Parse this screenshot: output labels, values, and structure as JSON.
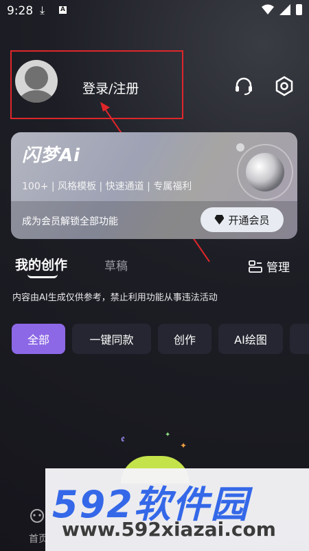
{
  "status_bar": {
    "time": "9:28",
    "download_glyph": "⤓",
    "a_glyph": "A"
  },
  "profile": {
    "login_text": "登录/注册"
  },
  "vip": {
    "title": "闪梦Ai",
    "perks": "100+ | 风格模板 | 快速通道 | 专属福利",
    "desc": "成为会员解锁全部功能",
    "button_label": "开通会员"
  },
  "tabs": {
    "active": "我的创作",
    "inactive": "草稿",
    "manage": "管理"
  },
  "disclaimer": "内容由AI生成仅供参考，禁止利用功能从事违法活动",
  "chips": [
    "全部",
    "一键同款",
    "创作",
    "AI绘图"
  ],
  "illustration": {
    "swirl": "ꬲ",
    "star1": "✦",
    "star2": "✦"
  },
  "bottom_nav": {
    "first_label": "首页"
  },
  "watermark": {
    "logo": "592软件园",
    "url": "www.592xiazai.com"
  },
  "colors": {
    "accent": "#8c68e6",
    "highlight": "#e0262a",
    "watermark_blue": "#3468e8"
  }
}
